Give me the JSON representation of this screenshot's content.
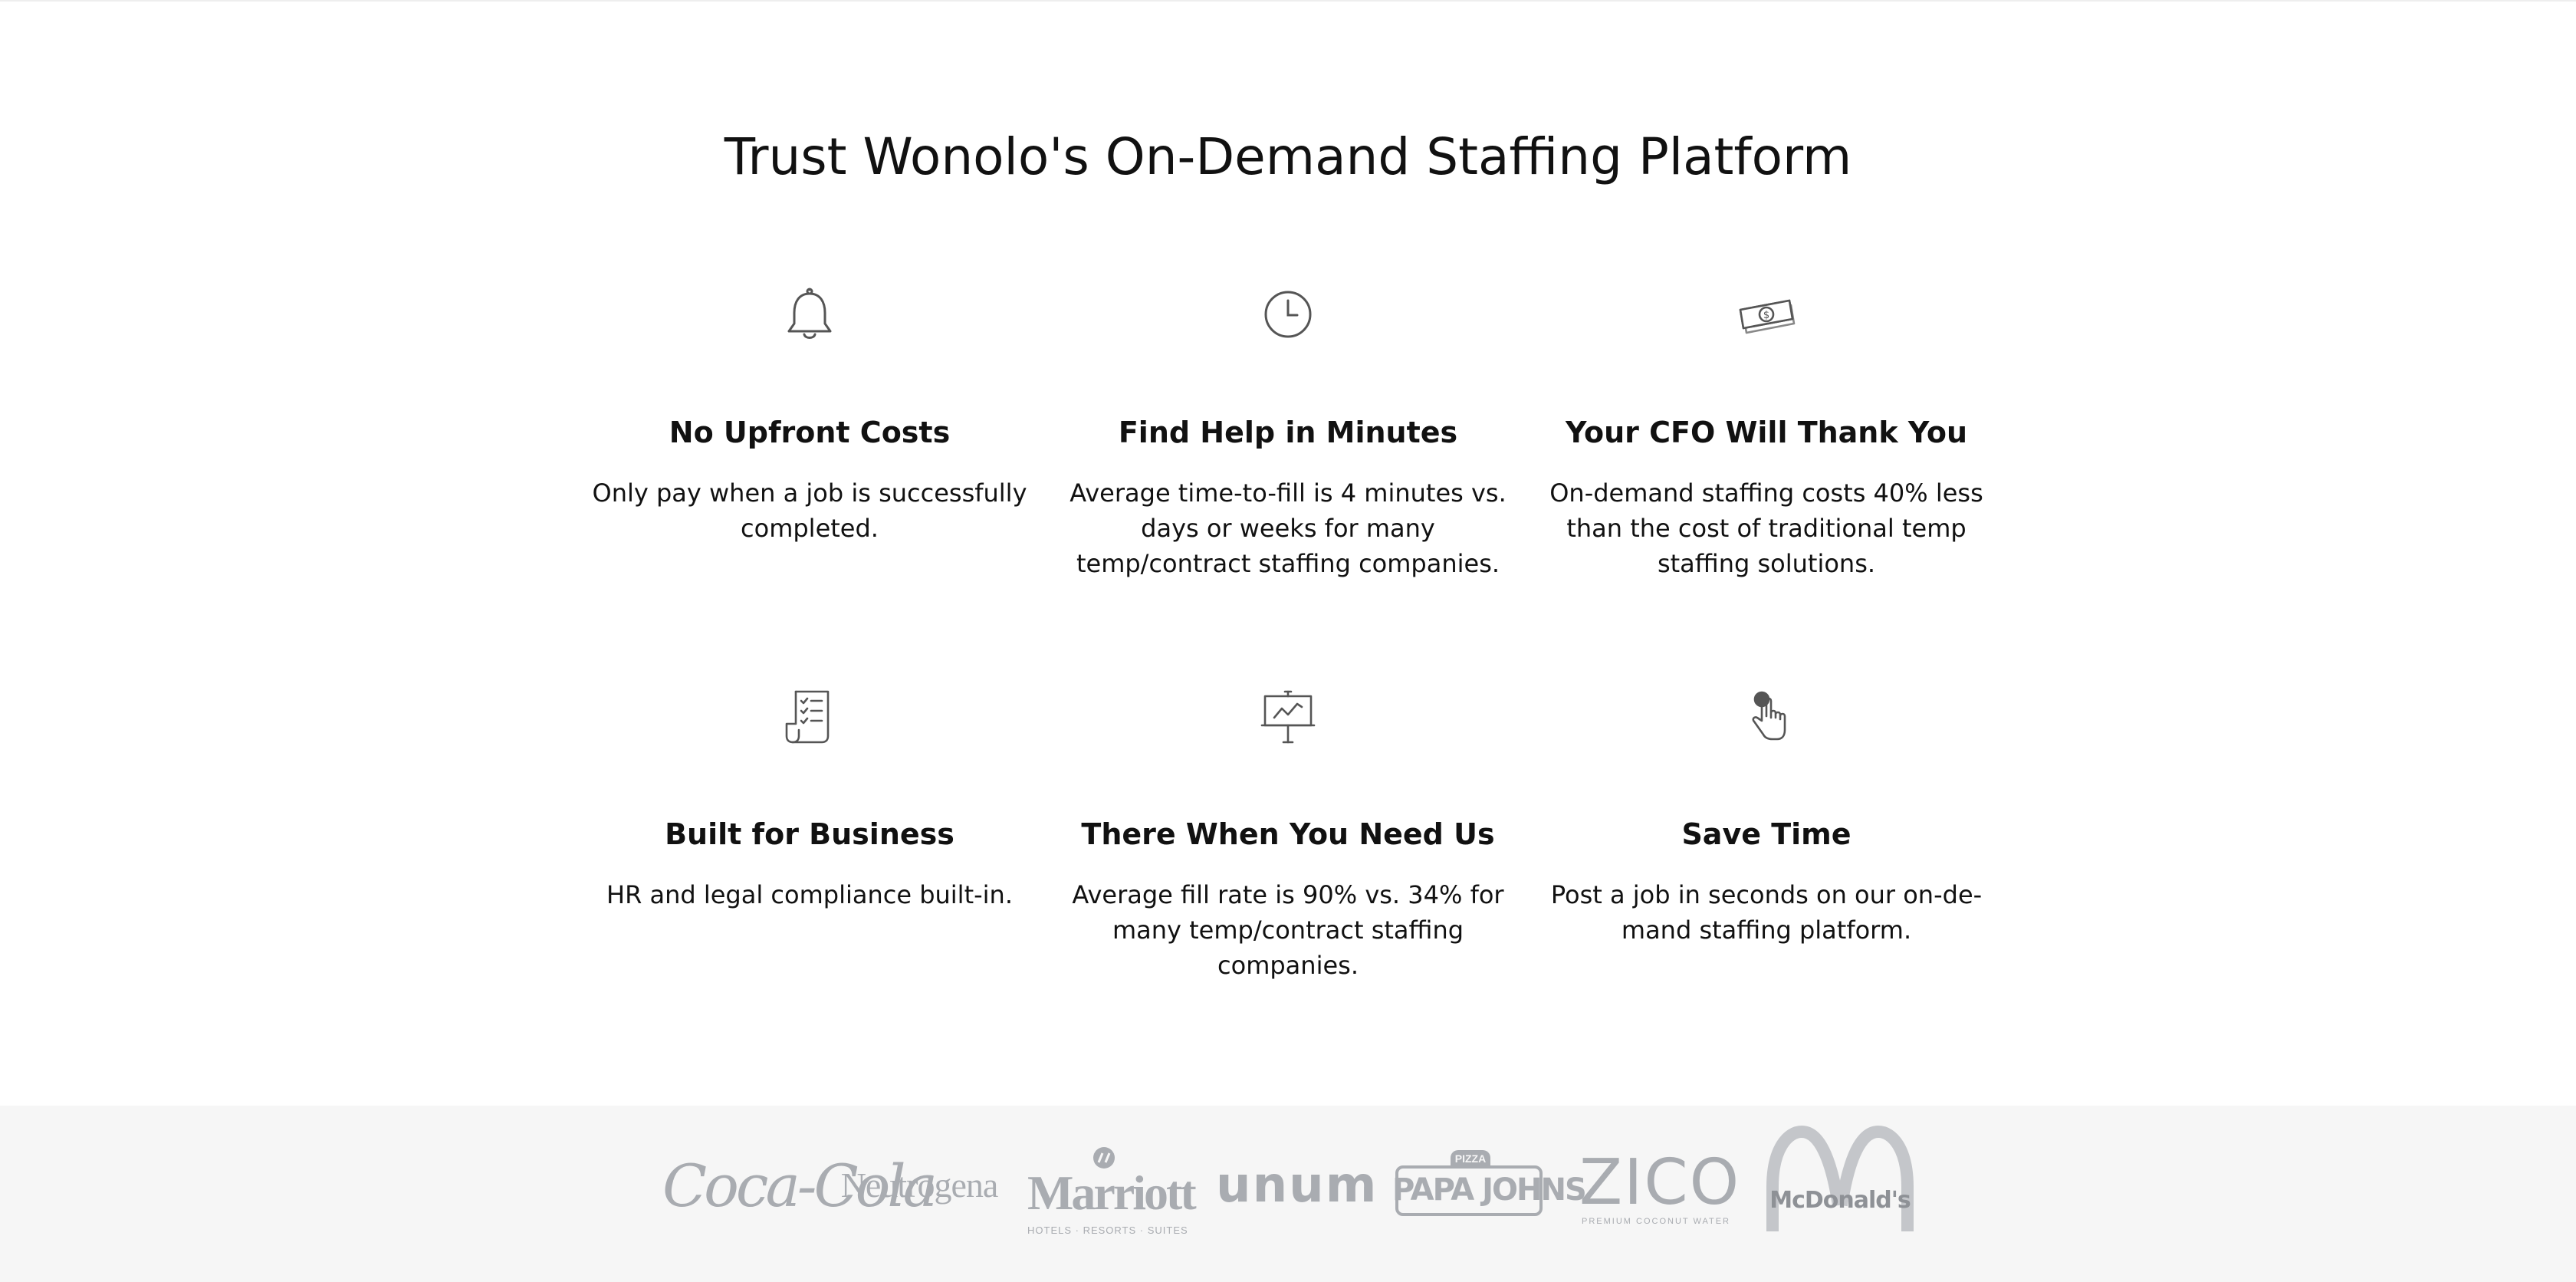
{
  "heading": "Trust Wonolo's On-Demand Staffing Platform",
  "features": [
    {
      "icon": "bell-icon",
      "title": "No Upfront Costs",
      "description": "Only pay when a job is successfully completed."
    },
    {
      "icon": "clock-icon",
      "title": "Find Help in Minutes",
      "description": "Average time-to-fill is 4 minutes vs. days or weeks for many temp/contract staffing companies."
    },
    {
      "icon": "money-icon",
      "title": "Your CFO Will Thank You",
      "description": "On-demand staffing costs 40% less than the cost of traditional temp staffing solutions."
    },
    {
      "icon": "checklist-icon",
      "title": "Built for Business",
      "description": "HR and legal compliance built-in."
    },
    {
      "icon": "presentation-board-icon",
      "title": "There When You Need Us",
      "description": "Average fill rate is 90% vs. 34% for many temp/contract staffing companies."
    },
    {
      "icon": "tap-hand-icon",
      "title": "Save Time",
      "description": "Post a job in seconds on our on-de-mand staffing platform."
    }
  ],
  "logos": {
    "coca_cola": "Coca-Cola",
    "neutrogena": "Neutrogena",
    "marriott": "Marriott",
    "marriott_tagline": "HOTELS · RESORTS · SUITES",
    "unum": "unum",
    "papa_johns": "PAPA JOHNS",
    "papa_johns_top": "PIZZA",
    "zico": "ZICO",
    "zico_tagline": "PREMIUM COCONUT WATER",
    "mcdonalds": "McDonald's"
  },
  "colors": {
    "text": "#111111",
    "icon_stroke": "#555555",
    "logo_gray": "#a9acb1",
    "band_background": "#f6f6f6"
  }
}
